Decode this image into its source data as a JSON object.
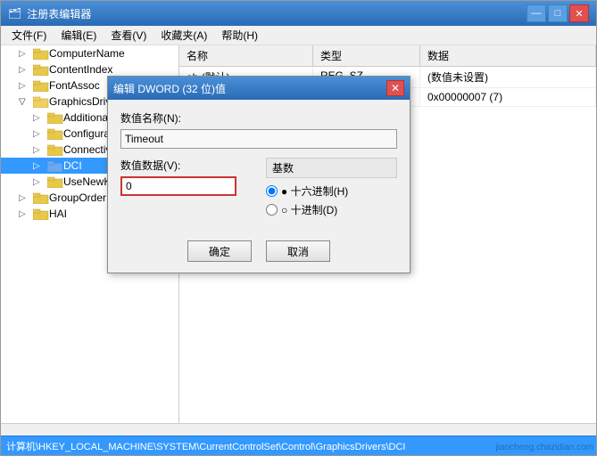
{
  "window": {
    "title": "注册表编辑器",
    "icon": "🗂"
  },
  "menu": {
    "items": [
      "文件(F)",
      "编辑(E)",
      "查看(V)",
      "收藏夹(A)",
      "帮助(H)"
    ]
  },
  "title_controls": {
    "minimize": "—",
    "maximize": "□",
    "close": "✕"
  },
  "tree": {
    "items": [
      {
        "label": "ComputerName",
        "indent": 1,
        "expanded": false
      },
      {
        "label": "ContentIndex",
        "indent": 1,
        "expanded": false
      },
      {
        "label": "FontAssoc",
        "indent": 1,
        "expanded": false
      },
      {
        "label": "GraphicsDrivers",
        "indent": 1,
        "expanded": true
      },
      {
        "label": "AdditionalMo...",
        "indent": 2,
        "expanded": false
      },
      {
        "label": "Configuration",
        "indent": 2,
        "expanded": false
      },
      {
        "label": "Connectivity",
        "indent": 2,
        "expanded": false
      },
      {
        "label": "DCI",
        "indent": 2,
        "expanded": false,
        "selected": true
      },
      {
        "label": "UseNewKey",
        "indent": 2,
        "expanded": false
      },
      {
        "label": "GroupOrderList",
        "indent": 1,
        "expanded": false
      },
      {
        "label": "HAI",
        "indent": 1,
        "expanded": false
      }
    ]
  },
  "values_panel": {
    "columns": [
      "名称",
      "类型",
      "数据"
    ],
    "rows": [
      {
        "name": "ab (默认)",
        "type": "REG_SZ",
        "data": "(数值未设置)"
      },
      {
        "name": "",
        "type": "",
        "data": "0x00000007 (7)"
      }
    ]
  },
  "dialog": {
    "title": "编辑 DWORD (32 位)值",
    "value_name_label": "数值名称(N):",
    "value_name": "Timeout",
    "value_data_label": "数值数据(V):",
    "value_data": "0",
    "base_title": "基数",
    "hex_label": "● 十六进制(H)",
    "dec_label": "○ 十进制(D)",
    "ok_label": "确定",
    "cancel_label": "取消"
  },
  "status_bar": {
    "path": "计算机\\HKEY_LOCAL_MACHINE\\SYSTEM\\CurrentControlSet\\Control\\GraphicsDrivers\\DCI"
  },
  "watermark": "jiaocheng.chazidian.com"
}
